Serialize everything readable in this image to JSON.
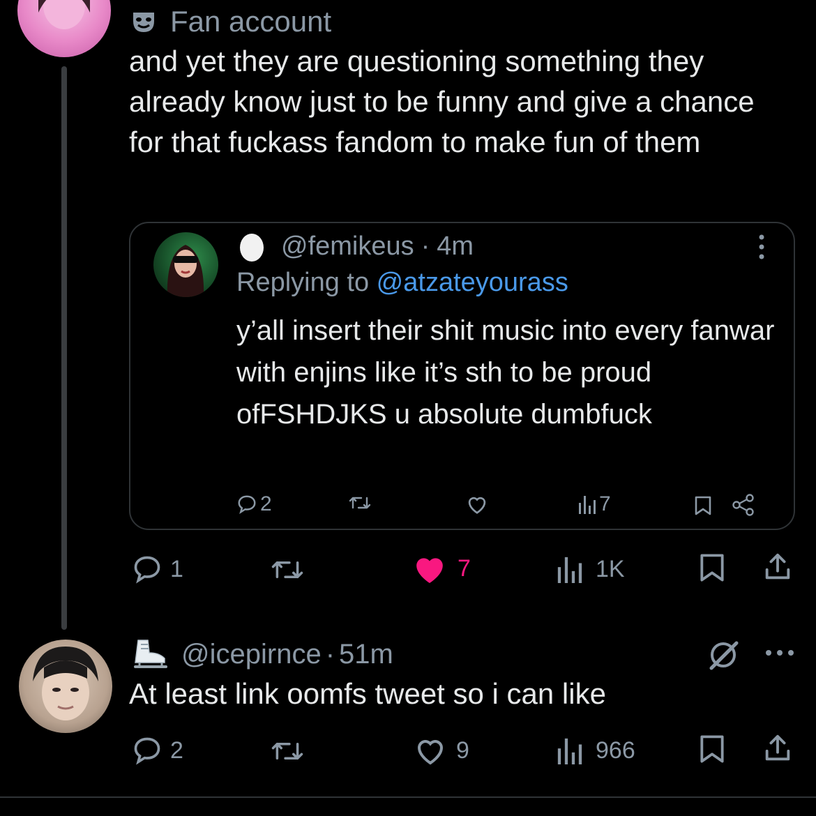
{
  "colors": {
    "background": "#000000",
    "text": "#e7e9ea",
    "muted": "#8b98a5",
    "link": "#4a99e9",
    "liked": "#f91880"
  },
  "tweet1": {
    "badge_icon": "mask-icon",
    "badge_label": "Fan account",
    "text": "and yet they are questioning something they already know just to be funny and give a chance for that fuckass fandom to make fun of them",
    "actions": {
      "replies": "1",
      "likes": "7",
      "views": "1K"
    },
    "quote": {
      "emoji": "egg-icon",
      "handle": "@femikeus",
      "separator": "·",
      "time": "4m",
      "replying_prefix": "Replying to ",
      "replying_handle": "@atzateyourass",
      "text": "y’all insert their shit music into every fanwar with enjins like it’s sth to be proud ofFSHDJKS u absolute dumbfuck",
      "actions": {
        "replies": "2",
        "views": "7"
      }
    }
  },
  "tweet2": {
    "emoji": "ice-skate-icon",
    "handle": "@icepirnce",
    "separator": "·",
    "time": "51m",
    "text": "At least link oomfs tweet so i can like",
    "actions": {
      "replies": "2",
      "likes": "9",
      "views": "966"
    }
  }
}
